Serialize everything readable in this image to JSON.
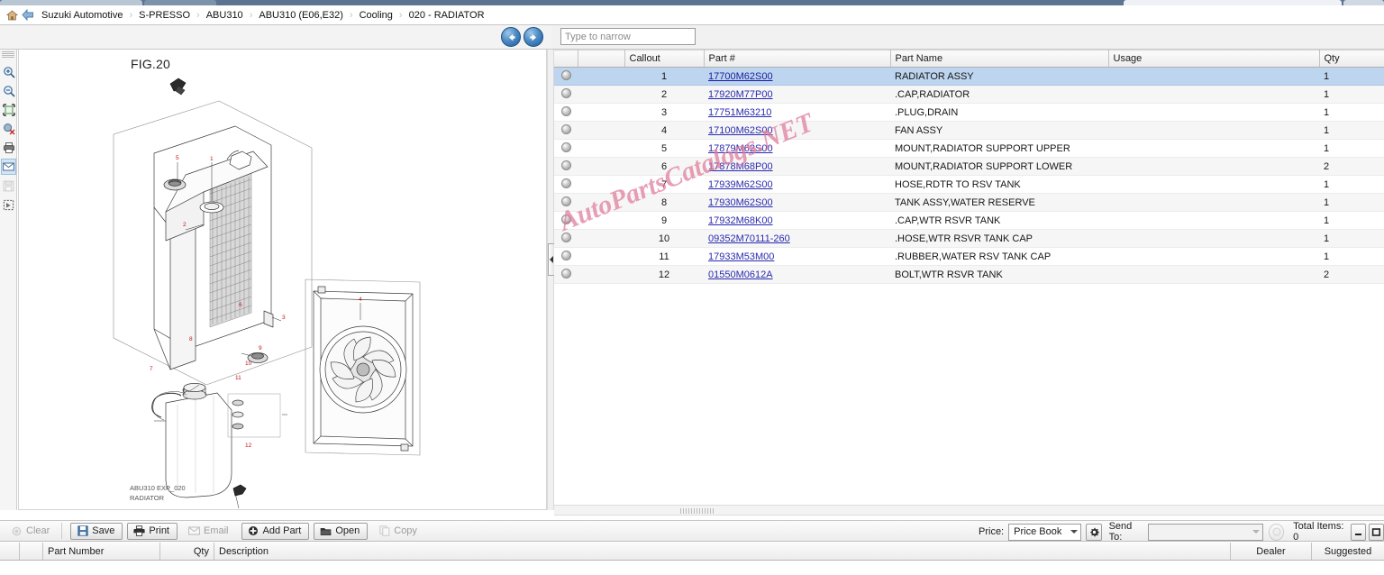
{
  "breadcrumb": {
    "home_icon": "home-icon",
    "back_icon": "back-arrow-icon",
    "separator": "›",
    "items": [
      "Suzuki Automotive",
      "S-PRESSO",
      "ABU310",
      "ABU310 (E06,E32)",
      "Cooling",
      "020 - RADIATOR"
    ]
  },
  "nav": {
    "prev_label": "previous-illustration",
    "next_label": "next-illustration"
  },
  "filter": {
    "placeholder": "Type to narrow",
    "value": ""
  },
  "rail": {
    "items": [
      "zoom-in-icon",
      "zoom-out-icon",
      "fit-to-window-icon",
      "zoom-reset-icon",
      "print-icon",
      "email-icon",
      "save-image-icon",
      "select-region-icon"
    ]
  },
  "diagram": {
    "fig_label": "FIG.20",
    "caption_line1": "ABU310 EXP_020",
    "caption_line2": "RADIATOR",
    "callouts": [
      "1",
      "2",
      "3",
      "4",
      "5",
      "6",
      "7",
      "8",
      "9",
      "10",
      "11",
      "12"
    ]
  },
  "watermark": {
    "text": "AutoPartsCatalogs.NET",
    "color": "#e07a9a"
  },
  "table": {
    "columns": [
      "",
      "",
      "Callout",
      "Part #",
      "Part Name",
      "Usage",
      "Qty"
    ],
    "rows": [
      {
        "icon": "part-info-icon",
        "callout": "1",
        "part": "17700M62S00",
        "name": "RADIATOR ASSY",
        "usage": "",
        "qty": "1",
        "selected": true
      },
      {
        "icon": "part-info-icon",
        "callout": "2",
        "part": "17920M77P00",
        "name": ".CAP,RADIATOR",
        "usage": "",
        "qty": "1"
      },
      {
        "icon": "part-info-icon",
        "callout": "3",
        "part": "17751M63210",
        "name": ".PLUG,DRAIN",
        "usage": "",
        "qty": "1"
      },
      {
        "icon": "part-info-icon",
        "callout": "4",
        "part": "17100M62S00",
        "name": "FAN ASSY",
        "usage": "",
        "qty": "1"
      },
      {
        "icon": "part-info-icon",
        "callout": "5",
        "part": "17879M62S00",
        "name": "MOUNT,RADIATOR SUPPORT UPPER",
        "usage": "",
        "qty": "1"
      },
      {
        "icon": "part-info-icon",
        "callout": "6",
        "part": "17878M68P00",
        "name": "MOUNT,RADIATOR SUPPORT LOWER",
        "usage": "",
        "qty": "2"
      },
      {
        "icon": "part-info-icon",
        "callout": "7",
        "part": "17939M62S00",
        "name": "HOSE,RDTR TO RSV TANK",
        "usage": "",
        "qty": "1"
      },
      {
        "icon": "part-info-icon",
        "callout": "8",
        "part": "17930M62S00",
        "name": "TANK ASSY,WATER RESERVE",
        "usage": "",
        "qty": "1"
      },
      {
        "icon": "part-info-icon",
        "callout": "9",
        "part": "17932M68K00",
        "name": ".CAP,WTR RSVR TANK",
        "usage": "",
        "qty": "1"
      },
      {
        "icon": "part-info-icon",
        "callout": "10",
        "part": "09352M70111-260",
        "name": ".HOSE,WTR RSVR TANK CAP",
        "usage": "",
        "qty": "1"
      },
      {
        "icon": "part-info-icon",
        "callout": "11",
        "part": "17933M53M00",
        "name": ".RUBBER,WATER RSV TANK CAP",
        "usage": "",
        "qty": "1"
      },
      {
        "icon": "part-info-icon",
        "callout": "12",
        "part": "01550M0612A",
        "name": "BOLT,WTR RSVR TANK",
        "usage": "",
        "qty": "2"
      }
    ]
  },
  "toolbar": {
    "buttons": [
      {
        "label": "Clear",
        "icon": "clear-icon",
        "enabled": false
      },
      {
        "label": "Save",
        "icon": "floppy-icon",
        "enabled": true
      },
      {
        "label": "Print",
        "icon": "printer-icon",
        "enabled": true
      },
      {
        "label": "Email",
        "icon": "envelope-icon",
        "enabled": false
      },
      {
        "label": "Add Part",
        "icon": "plus-disc-icon",
        "enabled": true
      },
      {
        "label": "Open",
        "icon": "folder-icon",
        "enabled": true
      },
      {
        "label": "Copy",
        "icon": "copy-icon",
        "enabled": false
      }
    ],
    "price_label": "Price:",
    "price_value": "Price Book",
    "gear_icon": "gear-icon",
    "sendto_label": "Send To:",
    "sendto_value": "",
    "sendto_go_icon": "send-icon",
    "total_items_label": "Total Items: 0",
    "minimize_icon": "minimize-icon",
    "restore_icon": "restore-icon"
  },
  "basket": {
    "columns": [
      "",
      "",
      "Part Number",
      "Qty",
      "Description",
      "",
      "Dealer",
      "Suggested"
    ]
  }
}
